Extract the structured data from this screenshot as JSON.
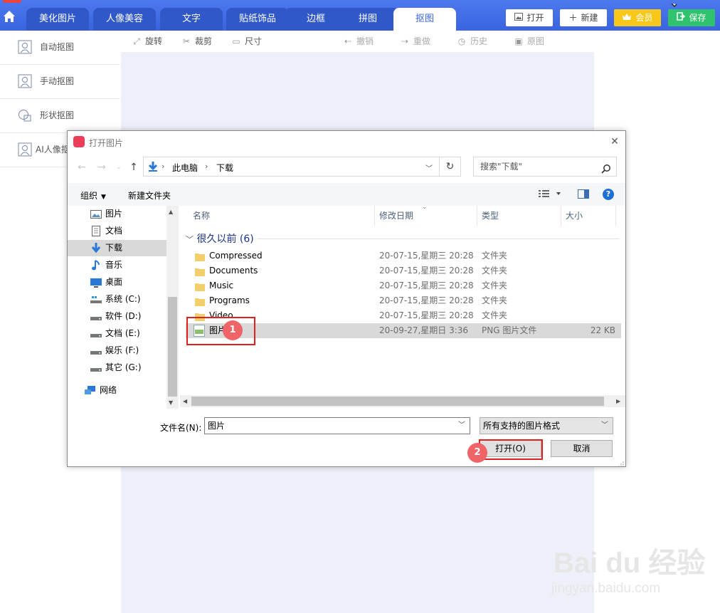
{
  "app": {
    "tabs": [
      {
        "label": "美化图片"
      },
      {
        "label": "人像美容"
      },
      {
        "label": "文字"
      },
      {
        "label": "贴纸饰品"
      },
      {
        "label": "边框"
      },
      {
        "label": "拼图"
      },
      {
        "label": "抠图",
        "active": true
      }
    ],
    "top_buttons": {
      "open": "打开",
      "new": "新建",
      "vip": "会员",
      "save": "保存"
    },
    "sidebar": [
      {
        "label": "自动抠图",
        "icon": "auto-cutout-icon"
      },
      {
        "label": "手动抠图",
        "icon": "manual-cutout-icon"
      },
      {
        "label": "形状抠图",
        "icon": "shape-cutout-icon"
      },
      {
        "label": "AI人像抠",
        "icon": "ai-portrait-icon"
      }
    ],
    "toolbar": [
      {
        "label": "旋转",
        "icon": "rotate-icon"
      },
      {
        "label": "裁剪",
        "icon": "crop-icon"
      },
      {
        "label": "尺寸",
        "icon": "resize-icon"
      },
      {
        "label": "撤销",
        "icon": "undo-icon"
      },
      {
        "label": "重做",
        "icon": "redo-icon"
      },
      {
        "label": "历史",
        "icon": "history-icon"
      },
      {
        "label": "原图",
        "icon": "original-image-icon"
      }
    ],
    "colors": {
      "topbar": "#3a64e0",
      "vip": "#f7c81a",
      "save": "#31c26e",
      "work_bg": "#eef0f9"
    }
  },
  "dialog": {
    "title": "打开图片",
    "address": {
      "segments": [
        "此电脑",
        "下载"
      ]
    },
    "search_placeholder": "搜索\"下载\"",
    "commands": {
      "organize": "组织",
      "new_folder": "新建文件夹"
    },
    "nav_items": [
      {
        "label": "图片",
        "icon": "pictures-icon"
      },
      {
        "label": "文档",
        "icon": "documents-icon"
      },
      {
        "label": "下载",
        "icon": "downloads-icon",
        "selected": true
      },
      {
        "label": "音乐",
        "icon": "music-icon"
      },
      {
        "label": "桌面",
        "icon": "desktop-icon"
      },
      {
        "label": "系统 (C:)",
        "icon": "system-drive-icon"
      },
      {
        "label": "软件 (D:)",
        "icon": "drive-icon"
      },
      {
        "label": "文档 (E:)",
        "icon": "drive-icon"
      },
      {
        "label": "娱乐 (F:)",
        "icon": "drive-icon"
      },
      {
        "label": "其它 (G:)",
        "icon": "drive-icon"
      },
      {
        "label": "网络",
        "icon": "network-icon"
      }
    ],
    "columns": {
      "name": "名称",
      "modified": "修改日期",
      "type": "类型",
      "size": "大小"
    },
    "group": "很久以前 (6)",
    "files": [
      {
        "name": "Compressed",
        "modified": "20-07-15,星期三 20:28",
        "type": "文件夹",
        "size": "",
        "kind": "folder"
      },
      {
        "name": "Documents",
        "modified": "20-07-15,星期三 20:28",
        "type": "文件夹",
        "size": "",
        "kind": "folder"
      },
      {
        "name": "Music",
        "modified": "20-07-15,星期三 20:28",
        "type": "文件夹",
        "size": "",
        "kind": "folder"
      },
      {
        "name": "Programs",
        "modified": "20-07-15,星期三 20:28",
        "type": "文件夹",
        "size": "",
        "kind": "folder"
      },
      {
        "name": "Video",
        "modified": "20-07-15,星期三 20:28",
        "type": "文件夹",
        "size": "",
        "kind": "folder"
      },
      {
        "name": "图片",
        "modified": "20-09-27,星期日 3:36",
        "type": "PNG 图片文件",
        "size": "22 KB",
        "kind": "png",
        "selected": true
      }
    ],
    "filename_label": "文件名(N):",
    "filename_value": "图片",
    "filetype_value": "所有支持的图片格式",
    "open_button": "打开(O)",
    "cancel_button": "取消"
  },
  "annotations": {
    "step1": "1",
    "step2": "2"
  },
  "watermark": {
    "logo": "Bai du 经验",
    "url": "jingyan.baidu.com"
  }
}
